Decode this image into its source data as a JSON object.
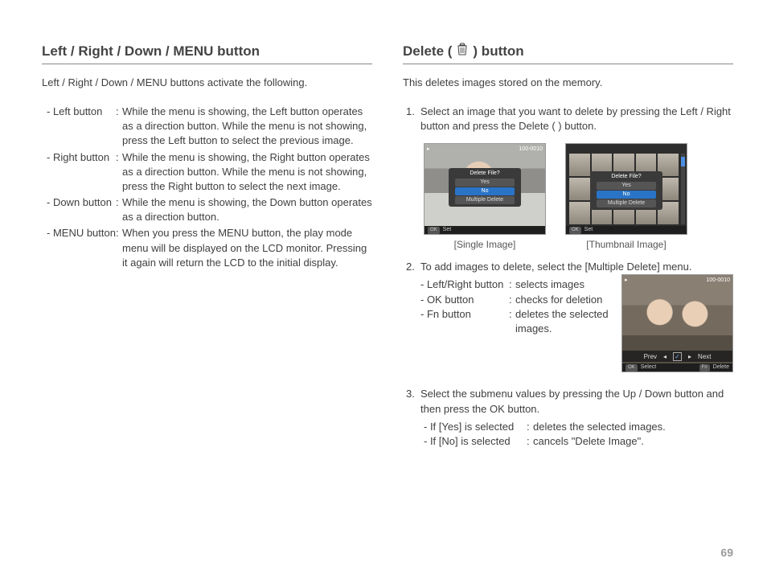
{
  "left": {
    "title": "Left / Right / Down / MENU button",
    "intro": "Left / Right / Down / MENU buttons activate the following.",
    "items": [
      {
        "term": "- Left button",
        "desc": "While the menu is showing, the Left button operates as a direction button. While the menu is not showing, press the Left button to select the previous image."
      },
      {
        "term": "- Right button",
        "desc": "While the menu is showing, the Right button operates as a direction button. While the menu is not showing, press the Right button to select the next image."
      },
      {
        "term": "- Down button",
        "desc": "While the menu is showing, the Down button operates as a direction button."
      },
      {
        "term": "- MENU button",
        "desc": "When you press the MENU button, the play mode menu will be displayed on the LCD monitor. Pressing it again will return the LCD to the initial display."
      }
    ]
  },
  "right": {
    "title_pre": "Delete (",
    "title_post": ") button",
    "intro": "This deletes images stored on the memory.",
    "step1": "Select an image that you want to delete by pressing the Left / Right button and press the Delete (      ) button.",
    "lcd": {
      "counter": "100-0010",
      "dialog_title": "Delete File?",
      "opt_yes": "Yes",
      "opt_no": "No",
      "opt_multi": "Multiple Delete",
      "ok": "OK",
      "set": "Set",
      "select": "Select",
      "fn": "Fn",
      "del": "Delete",
      "prev": "Prev",
      "next": "Next"
    },
    "captions": {
      "single": "[Single Image]",
      "thumb": "[Thumbnail Image]"
    },
    "step2_lead": "To add images to delete, select the [Multiple Delete] menu.",
    "step2_subs": [
      {
        "term": "- Left/Right button",
        "desc": "selects images"
      },
      {
        "term": "- OK button",
        "desc": "checks for deletion"
      },
      {
        "term": "- Fn button",
        "desc": "deletes the selected images."
      }
    ],
    "step3_lead": "Select the submenu values by pressing the Up / Down button and then press the OK button.",
    "step3_subs": [
      {
        "term": "- If [Yes] is selected",
        "desc": "deletes the selected images."
      },
      {
        "term": "- If [No] is selected",
        "desc": "cancels \"Delete Image\"."
      }
    ]
  },
  "page_number": "69"
}
